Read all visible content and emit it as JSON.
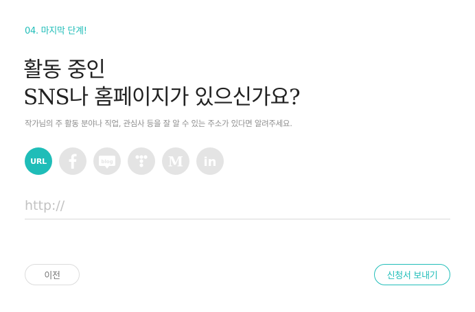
{
  "step_label": "04. 마지막 단계!",
  "title": {
    "line1": "활동 중인",
    "line2": "SNS나 홈페이지가 있으신가요?"
  },
  "subtitle": "작가님의 주 활동 분야나 직업, 관심사 등을 잘 알 수 있는 주소가 있다면 알려주세요.",
  "socials": [
    {
      "id": "url",
      "label": "URL",
      "icon": "link-url-icon",
      "active": true
    },
    {
      "id": "facebook",
      "label": "f",
      "icon": "facebook-icon",
      "active": false
    },
    {
      "id": "blog",
      "label": "blog",
      "icon": "blog-icon",
      "active": false
    },
    {
      "id": "twitter",
      "label": "",
      "icon": "twitter-t-icon",
      "active": false
    },
    {
      "id": "medium",
      "label": "M",
      "icon": "medium-icon",
      "active": false
    },
    {
      "id": "linkedin",
      "label": "in",
      "icon": "linkedin-icon",
      "active": false
    }
  ],
  "url_input": {
    "placeholder": "http://",
    "value": ""
  },
  "buttons": {
    "prev": "이전",
    "submit": "신청서 보내기"
  },
  "colors": {
    "accent": "#1fbdb8",
    "icon_inactive_bg": "#e4e4e4",
    "text_muted": "#8e8e8e"
  }
}
